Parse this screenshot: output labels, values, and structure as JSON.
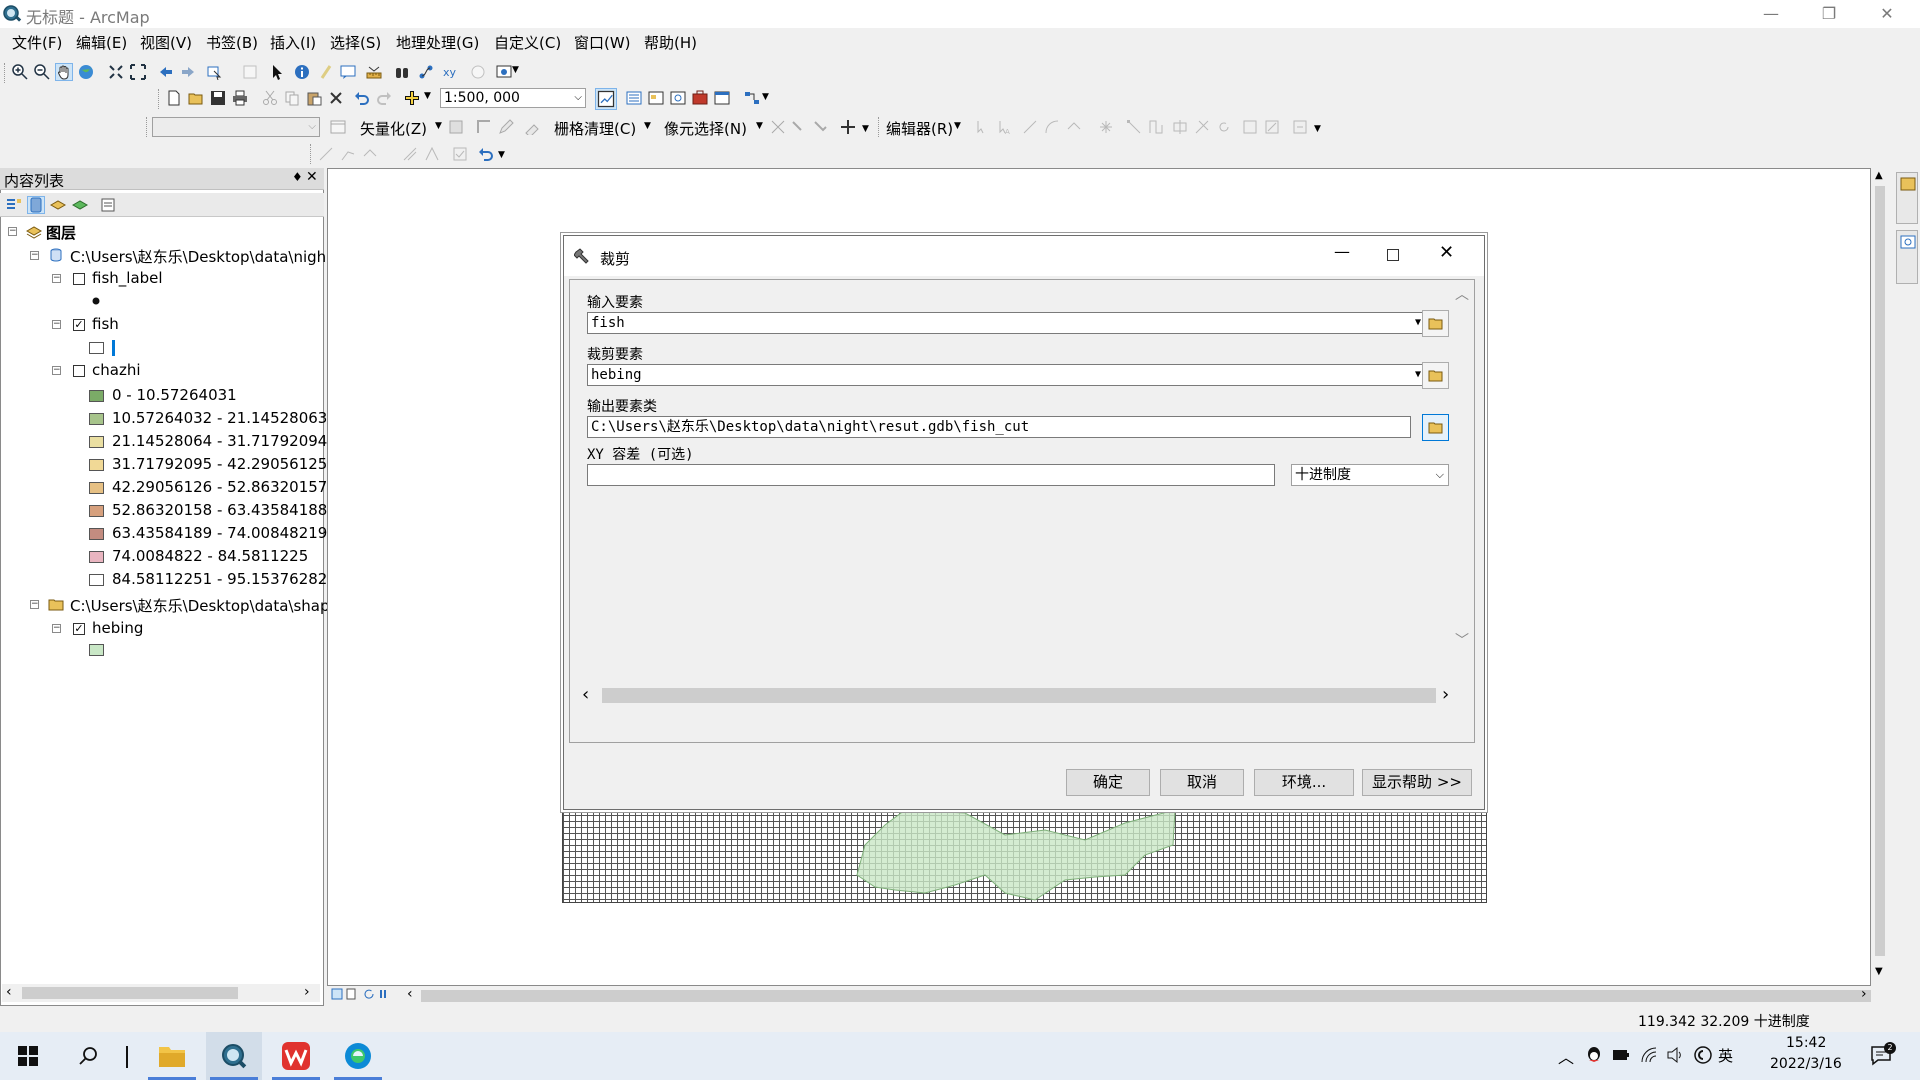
{
  "window": {
    "title": "无标题 - ArcMap",
    "min": "—",
    "restore": "❐",
    "close": "✕"
  },
  "menu": [
    "文件(F)",
    "编辑(E)",
    "视图(V)",
    "书签(B)",
    "插入(I)",
    "选择(S)",
    "地理处理(G)",
    "自定义(C)",
    "窗口(W)",
    "帮助(H)"
  ],
  "toolbar": {
    "scale": "1:500, 000",
    "vectorize": "矢量化(Z)",
    "raster_cleanup": "栅格清理(C)",
    "cell_select": "像元选择(N)",
    "editor": "编辑器(R)"
  },
  "toc": {
    "title": "内容列表",
    "pin": "♦",
    "close": "✕",
    "root": "图层",
    "groups": [
      {
        "path": "C:\\Users\\赵东乐\\Desktop\\data\\nigh"
      },
      {
        "path": "C:\\Users\\赵东乐\\Desktop\\data\\shap"
      }
    ],
    "layers": {
      "fish_label": "fish_label",
      "fish": "fish",
      "chazhi": "chazhi",
      "hebing": "hebing"
    },
    "classes": [
      {
        "label": "0 - 10.57264031",
        "color": "#7bab67"
      },
      {
        "label": "10.57264032 - 21.14528063",
        "color": "#a7c48b"
      },
      {
        "label": "21.14528064 - 31.71792094",
        "color": "#eadfa2"
      },
      {
        "label": "31.71792095 - 42.29056125",
        "color": "#f1d996"
      },
      {
        "label": "42.29056126 - 52.86320157",
        "color": "#e6c084"
      },
      {
        "label": "52.86320158 - 63.43584188",
        "color": "#d6a07d"
      },
      {
        "label": "63.43584189 - 74.00848219",
        "color": "#c38c80"
      },
      {
        "label": "74.0084822 - 84.5811225",
        "color": "#e9b5c0"
      },
      {
        "label": "84.58112251 - 95.15376282",
        "color": "#ffffff"
      }
    ],
    "hebing_color": "#c9e7c6"
  },
  "dialog": {
    "title": "裁剪",
    "input_label": "输入要素",
    "input_value": "fish",
    "clip_label": "裁剪要素",
    "clip_value": "hebing",
    "output_label": "输出要素类",
    "output_value": "C:\\Users\\赵东乐\\Desktop\\data\\night\\resut.gdb\\fish_cut",
    "xy_label": "XY 容差 (可选)",
    "xy_value": "",
    "unit_value": "十进制度",
    "ok": "确定",
    "cancel": "取消",
    "env": "环境...",
    "help": "显示帮助 >>"
  },
  "status": {
    "coords": "119.342  32.209 十进制度"
  },
  "taskbar": {
    "time": "15:42",
    "date": "2022/3/16",
    "ime": "英"
  },
  "colors": {
    "accent": "#0078d7",
    "polygon": "#c9e7c6"
  }
}
